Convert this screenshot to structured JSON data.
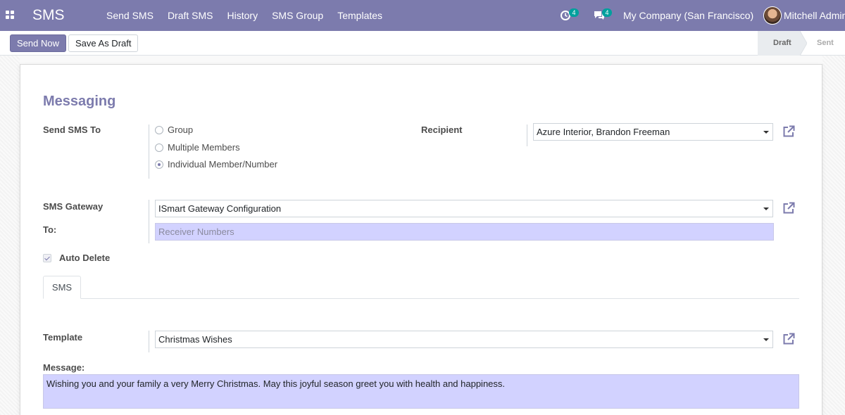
{
  "navbar": {
    "app_title": "SMS",
    "menu": [
      "Send SMS",
      "Draft SMS",
      "History",
      "SMS Group",
      "Templates"
    ],
    "activity_count": "4",
    "messages_count": "4",
    "company": "My Company (San Francisco)",
    "user": "Mitchell Admin"
  },
  "control": {
    "send_now": "Send Now",
    "save_draft": "Save As Draft",
    "stages": [
      "Draft",
      "Sent"
    ],
    "active_stage": "Draft"
  },
  "form": {
    "section_title": "Messaging",
    "send_sms_to_label": "Send SMS To",
    "send_options": [
      "Group",
      "Multiple Members",
      "Individual Member/Number"
    ],
    "selected_option": "Individual Member/Number",
    "recipient_label": "Recipient",
    "recipient_value": "Azure Interior, Brandon Freeman",
    "gateway_label": "SMS Gateway",
    "gateway_value": "ISmart Gateway Configuration",
    "to_label": "To:",
    "to_placeholder": "Receiver Numbers",
    "auto_delete_label": "Auto Delete",
    "auto_delete_checked": true,
    "tab_label": "SMS",
    "template_label": "Template",
    "template_value": "Christmas Wishes",
    "message_label": "Message:",
    "message_value": "Wishing you and your family a very Merry Christmas. May this joyful season greet you with health and happiness."
  },
  "icons": {
    "apps": "apps-grid-icon",
    "activity": "clock-icon",
    "messages": "chat-icon",
    "external": "external-link-icon"
  },
  "colors": {
    "brand": "#7c7bad",
    "badge": "#00a09d",
    "required_field": "#d2d2ff"
  }
}
